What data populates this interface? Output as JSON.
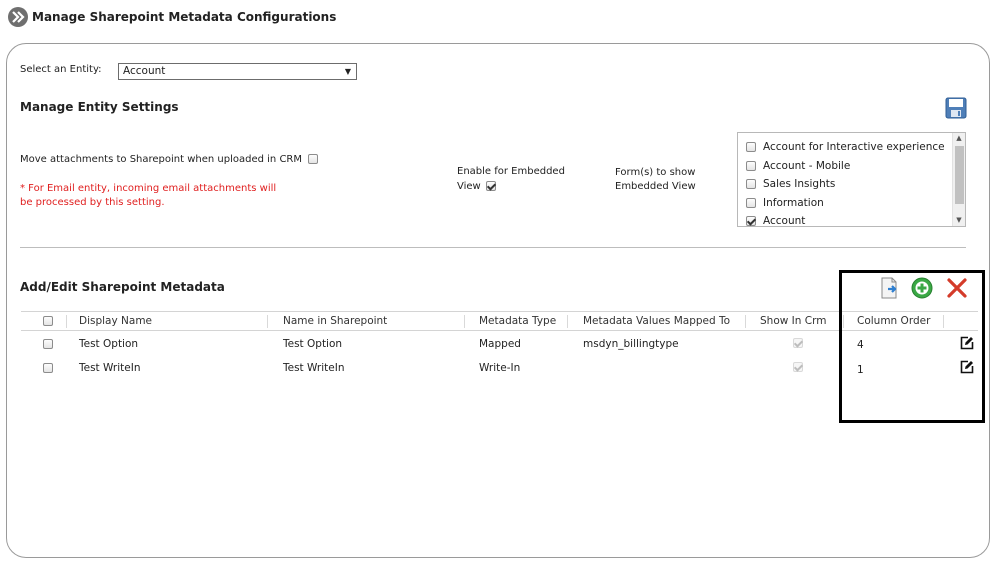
{
  "header": {
    "title": "Manage Sharepoint Metadata Configurations"
  },
  "entity": {
    "label": "Select an Entity:",
    "selected": "Account"
  },
  "settings": {
    "heading": "Manage Entity Settings",
    "move_attachments_label": "Move attachments to Sharepoint when uploaded in CRM",
    "move_attachments_checked": false,
    "note_line1": "* For Email entity, incoming email attachments will",
    "note_line2": "be processed by this setting.",
    "embedded_label_line1": "Enable for Embedded",
    "embedded_label_line2": "View",
    "embedded_checked": true,
    "forms_label_line1": "Form(s) to show",
    "forms_label_line2": "Embedded View",
    "forms": [
      {
        "label": "Account for Interactive experience",
        "checked": false
      },
      {
        "label": "Account - Mobile",
        "checked": false
      },
      {
        "label": "Sales Insights",
        "checked": false
      },
      {
        "label": "Information",
        "checked": false
      },
      {
        "label": "Account",
        "checked": true
      }
    ]
  },
  "metadata": {
    "heading": "Add/Edit Sharepoint Metadata",
    "columns": [
      "Display Name",
      "Name in Sharepoint",
      "Metadata Type",
      "Metadata Values Mapped To",
      "Show In Crm",
      "Column Order"
    ],
    "rows": [
      {
        "display_name": "Test Option",
        "sharepoint_name": "Test Option",
        "type": "Mapped",
        "mapped_to": "msdyn_billingtype",
        "show_in_crm": true,
        "order": "4"
      },
      {
        "display_name": "Test WriteIn",
        "sharepoint_name": "Test WriteIn",
        "type": "Write-In",
        "mapped_to": "",
        "show_in_crm": true,
        "order": "1"
      }
    ]
  },
  "icons": {
    "title": "double-chevron-icon",
    "save": "floppy-disk-icon",
    "import": "import-document-icon",
    "add": "green-plus-icon",
    "delete": "red-x-icon",
    "edit": "edit-pencil-icon"
  },
  "colors": {
    "note_red": "#e02020",
    "add_green": "#3aa845",
    "delete_red": "#d43b2a",
    "highlight_border": "#000000"
  }
}
